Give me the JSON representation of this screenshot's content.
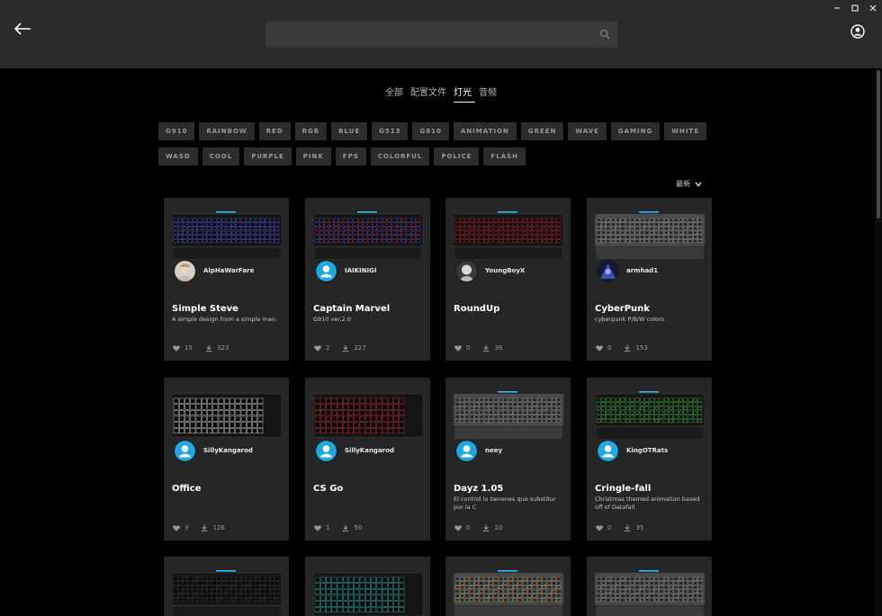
{
  "header": {
    "search_placeholder": "",
    "window_controls": [
      "minimize-icon",
      "maximize-icon",
      "close-icon"
    ]
  },
  "tabs": [
    {
      "label": "全部",
      "active": false
    },
    {
      "label": "配置文件",
      "active": false
    },
    {
      "label": "灯光",
      "active": true
    },
    {
      "label": "音频",
      "active": false
    }
  ],
  "tags_row1": [
    "G910",
    "RAINBOW",
    "RED",
    "RGB",
    "BLUE",
    "G513",
    "G810",
    "ANIMATION",
    "GREEN",
    "WAVE",
    "GAMING",
    "WHITE"
  ],
  "tags_row2": [
    "WASD",
    "COOL",
    "PURPLE",
    "PINK",
    "FPS",
    "COLORFUL",
    "POLICE",
    "FLASH"
  ],
  "sort_label": "最新",
  "cards": [
    {
      "author": "AlpHaWarFare",
      "title": "Simple Steve",
      "desc": "A simple design from a simple man.",
      "likes": "15",
      "downloads": "323"
    },
    {
      "author": "IAIKINIGI",
      "title": "Captain Marvel",
      "desc": "G910 ver.2.0",
      "likes": "2",
      "downloads": "227"
    },
    {
      "author": "YoungBoyX",
      "title": "RoundUp",
      "desc": "",
      "likes": "0",
      "downloads": "36"
    },
    {
      "author": "armhad1",
      "title": "CyberPunk",
      "desc": "cyberpunk P/B/W colors",
      "likes": "0",
      "downloads": "153"
    },
    {
      "author": "SillyKangarod",
      "title": "Office",
      "desc": "",
      "likes": "3",
      "downloads": "126"
    },
    {
      "author": "SillyKangarod",
      "title": "CS Go",
      "desc": "",
      "likes": "1",
      "downloads": "50"
    },
    {
      "author": "neey",
      "title": "Dayz 1.05",
      "desc": "El control lo tienenes que substitur por la C",
      "likes": "0",
      "downloads": "10"
    },
    {
      "author": "KingOTRats",
      "title": "Cringle-fall",
      "desc": "Christmas themed animation based off of Datafall",
      "likes": "0",
      "downloads": "35"
    }
  ],
  "colors": {
    "header_bg": "#2a2a2a",
    "card_bg": "#262626",
    "tag_bg": "#2c2c2c",
    "avatar_default": "#1ea7e1"
  }
}
